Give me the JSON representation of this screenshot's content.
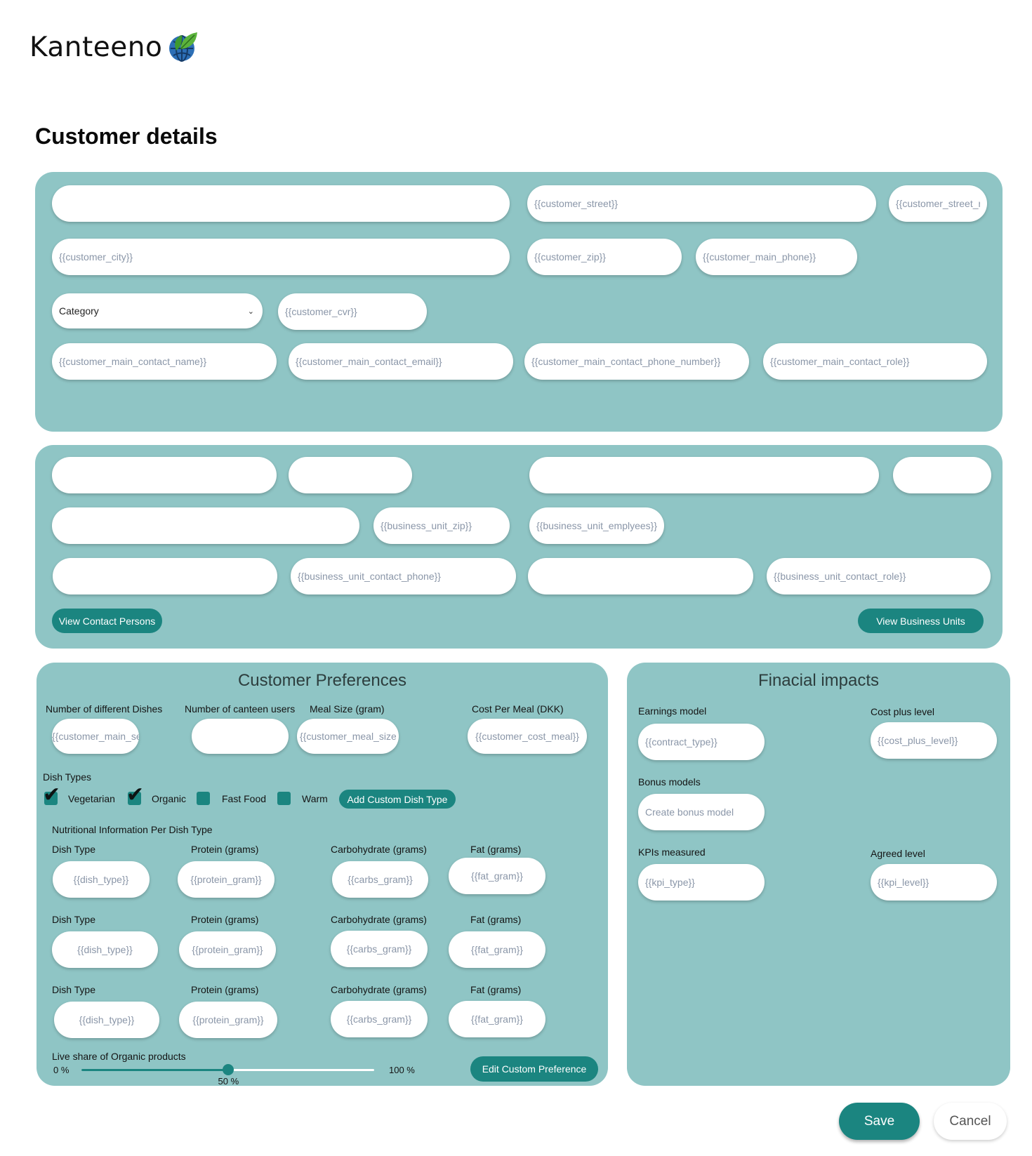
{
  "brand": {
    "name": "Kanteeno"
  },
  "page": {
    "title": "Customer details"
  },
  "customer": {
    "name": "",
    "street": "{{customer_street}}",
    "street_number": "{{customer_street_number}}",
    "city": "{{customer_city}}",
    "zip": "{{customer_zip}}",
    "main_phone": "{{customer_main_phone}}",
    "category_label": "Category",
    "cvr": "{{customer_cvr}}",
    "contact_name": "{{customer_main_contact_name}}",
    "contact_email": "{{customer_main_contact_email}}",
    "contact_phone": "{{customer_main_contact_phone_number}}",
    "contact_role": "{{customer_main_contact_role}}"
  },
  "business_unit": {
    "zip": "{{business_unit_zip}}",
    "employees": "{{business_unit_emplyees}}",
    "contact_phone": "{{business_unit_contact_phone}}",
    "contact_role": "{{business_unit_contact_role}}",
    "view_contacts_label": "View Contact Persons",
    "view_units_label": "View Business Units"
  },
  "preferences": {
    "title": "Customer Preferences",
    "dishes_label": "Number of different Dishes",
    "dishes_value": "{{customer_main_serve_dishes}}",
    "users_label": "Number of canteen users",
    "meal_size_label": "Meal Size (gram)",
    "meal_size_value": "{{customer_meal_size}}",
    "cost_label": "Cost Per Meal (DKK)",
    "cost_value": "{{customer_cost_meal}}",
    "dish_types_label": "Dish Types",
    "dish_types": [
      {
        "label": "Vegetarian",
        "checked": true
      },
      {
        "label": "Organic",
        "checked": true
      },
      {
        "label": "Fast Food",
        "checked": false
      },
      {
        "label": "Warm",
        "checked": false
      }
    ],
    "add_custom_label": "Add Custom Dish Type",
    "nutrition_title": "Nutritional Information Per Dish Type",
    "nutrition_headers": [
      "Dish Type",
      "Protein (grams)",
      "Carbohydrate (grams)",
      "Fat (grams)"
    ],
    "nutrition_rows": [
      [
        "{{dish_type}}",
        "{{protein_gram}}",
        "{{carbs_gram}}",
        "{{fat_gram}}"
      ],
      [
        "{{dish_type}}",
        "{{protein_gram}}",
        "{{carbs_gram}}",
        "{{fat_gram}}"
      ],
      [
        "{{dish_type}}",
        "{{protein_gram}}",
        "{{carbs_gram}}",
        "{{fat_gram}}"
      ]
    ],
    "organic_share_label": "Live share of Organic products",
    "slider_min": "0 %",
    "slider_max": "100 %",
    "slider_value_label": "50 %",
    "slider_value": 50,
    "edit_custom_label": "Edit Custom Preference"
  },
  "financial": {
    "title": "Finacial impacts",
    "earnings_label": "Earnings model",
    "earnings_value": "{{contract_type}}",
    "cost_plus_label": "Cost plus level",
    "cost_plus_value": "{{cost_plus_level}}",
    "bonus_label": "Bonus models",
    "bonus_value": "Create bonus model",
    "kpi_label": "KPIs measured",
    "kpi_value": "{{kpi_type}}",
    "agreed_label": "Agreed level",
    "agreed_value": "{{kpi_level}}"
  },
  "actions": {
    "save": "Save",
    "cancel": "Cancel"
  },
  "colors": {
    "panel": "#8fc5c5",
    "accent": "#1b8580"
  }
}
